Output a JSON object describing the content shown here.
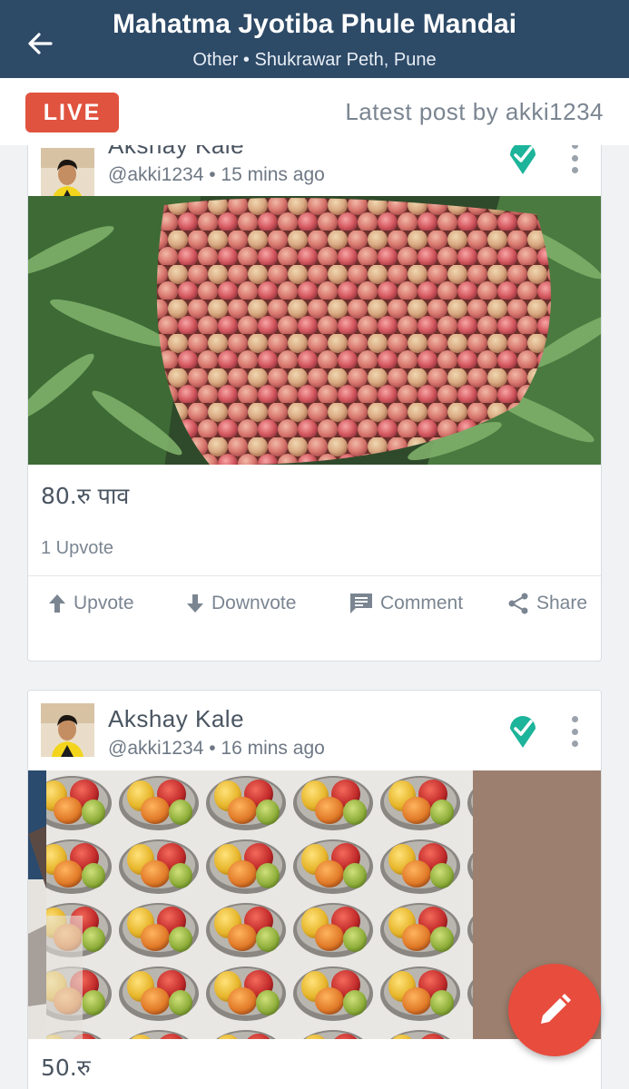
{
  "header": {
    "title": "Mahatma Jyotiba Phule Mandai",
    "subtitle": "Other • Shukrawar Peth, Pune"
  },
  "live_bar": {
    "badge": "LIVE",
    "latest_post": "Latest post by akki1234"
  },
  "posts": [
    {
      "author": "Akshay Kale",
      "meta": "@akki1234 • 15 mins ago",
      "price": "80.रु पाव",
      "upvotes": "1 Upvote",
      "photo_subject": "lychees"
    },
    {
      "author": "Akshay Kale",
      "meta": "@akki1234 • 16 mins ago",
      "price": "50.रु",
      "photo_subject": "mangoes"
    }
  ],
  "actions": {
    "upvote": "Upvote",
    "downvote": "Downvote",
    "comment": "Comment",
    "share": "Share"
  },
  "colors": {
    "header_bg": "#2d4a67",
    "live_badge": "#e0533f",
    "verified": "#1cb49a",
    "fab": "#e84c3d"
  },
  "icons": {
    "back": "arrow-left-icon",
    "verified": "verified-location-icon",
    "menu": "more-vertical-icon",
    "fab": "edit-pencil-icon"
  }
}
